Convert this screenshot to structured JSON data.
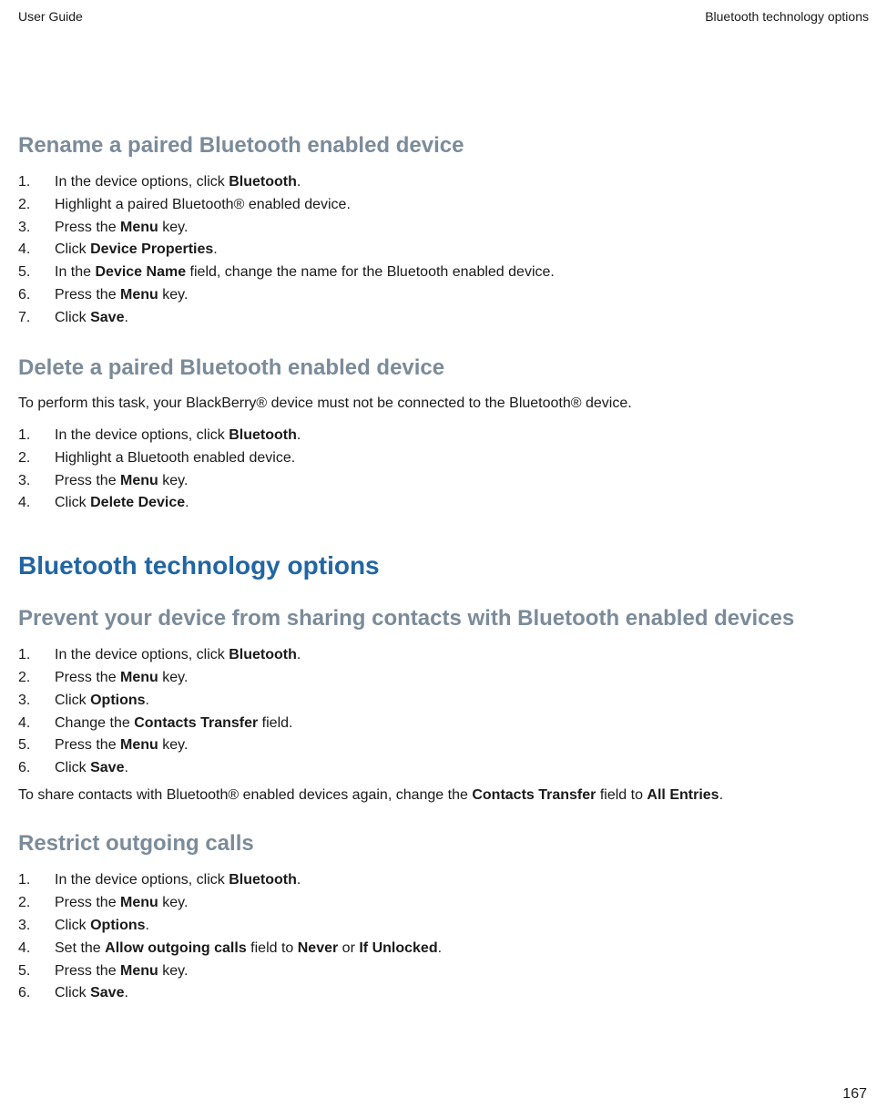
{
  "header": {
    "left": "User Guide",
    "right": "Bluetooth technology options"
  },
  "sections": {
    "rename": {
      "title": "Rename a paired Bluetooth enabled device",
      "steps": [
        {
          "pre": "In the device options, click ",
          "bold": "Bluetooth",
          "post": "."
        },
        {
          "pre": "Highlight a paired Bluetooth® enabled device.",
          "bold": "",
          "post": ""
        },
        {
          "pre": "Press the ",
          "bold": "Menu",
          "post": " key."
        },
        {
          "pre": "Click ",
          "bold": "Device Properties",
          "post": "."
        },
        {
          "pre": "In the ",
          "bold": "Device Name",
          "post": " field, change the name for the Bluetooth enabled device."
        },
        {
          "pre": "Press the ",
          "bold": "Menu",
          "post": " key."
        },
        {
          "pre": "Click ",
          "bold": "Save",
          "post": "."
        }
      ]
    },
    "delete": {
      "title": "Delete a paired Bluetooth enabled device",
      "intro": "To perform this task, your BlackBerry® device must not be connected to the Bluetooth® device.",
      "steps": [
        {
          "pre": "In the device options, click ",
          "bold": "Bluetooth",
          "post": "."
        },
        {
          "pre": "Highlight a Bluetooth enabled device.",
          "bold": "",
          "post": ""
        },
        {
          "pre": "Press the ",
          "bold": "Menu",
          "post": " key."
        },
        {
          "pre": "Click ",
          "bold": "Delete Device",
          "post": "."
        }
      ]
    },
    "options_heading": "Bluetooth technology options",
    "prevent": {
      "title": "Prevent your device from sharing contacts with Bluetooth enabled devices",
      "steps": [
        {
          "pre": "In the device options, click ",
          "bold": "Bluetooth",
          "post": "."
        },
        {
          "pre": "Press the ",
          "bold": "Menu",
          "post": " key."
        },
        {
          "pre": "Click ",
          "bold": "Options",
          "post": "."
        },
        {
          "pre": "Change the ",
          "bold": "Contacts Transfer",
          "post": " field."
        },
        {
          "pre": "Press the ",
          "bold": "Menu",
          "post": " key."
        },
        {
          "pre": "Click ",
          "bold": "Save",
          "post": "."
        }
      ],
      "outro_pre": "To share contacts with Bluetooth® enabled devices again, change the ",
      "outro_b1": "Contacts Transfer",
      "outro_mid": " field to ",
      "outro_b2": "All Entries",
      "outro_post": "."
    },
    "restrict": {
      "title": "Restrict outgoing calls",
      "steps": [
        {
          "pre": "In the device options, click ",
          "bold": "Bluetooth",
          "post": "."
        },
        {
          "pre": "Press the ",
          "bold": "Menu",
          "post": " key."
        },
        {
          "pre": "Click ",
          "bold": "Options",
          "post": "."
        },
        {
          "segments": [
            {
              "text": "Set the ",
              "bold": false
            },
            {
              "text": "Allow outgoing calls",
              "bold": true
            },
            {
              "text": " field to ",
              "bold": false
            },
            {
              "text": "Never",
              "bold": true
            },
            {
              "text": " or ",
              "bold": false
            },
            {
              "text": "If Unlocked",
              "bold": true
            },
            {
              "text": ".",
              "bold": false
            }
          ]
        },
        {
          "pre": "Press the ",
          "bold": "Menu",
          "post": " key."
        },
        {
          "pre": "Click ",
          "bold": "Save",
          "post": "."
        }
      ]
    }
  },
  "page_number": "167"
}
